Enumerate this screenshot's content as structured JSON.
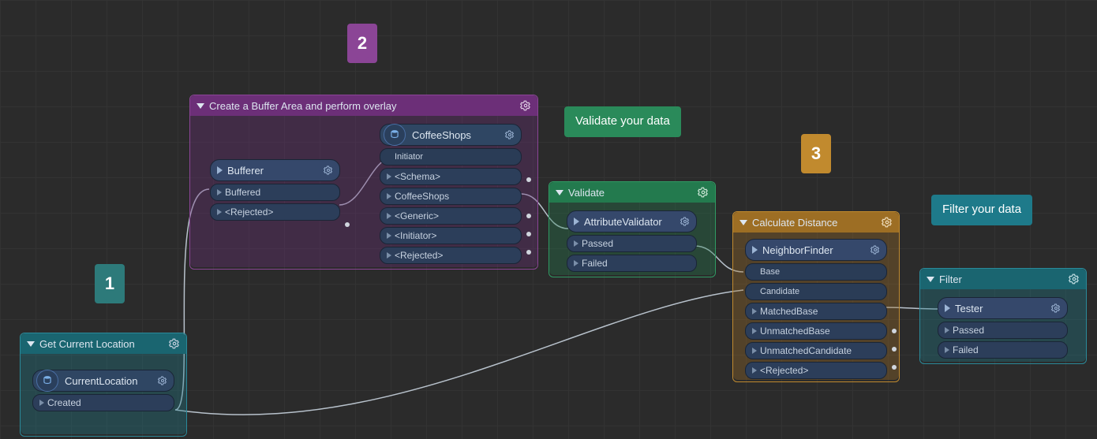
{
  "badges": {
    "one": "1",
    "two": "2",
    "three": "3"
  },
  "tips": {
    "validate": "Validate your data",
    "filter": "Filter your data"
  },
  "groups": {
    "loc": {
      "title": "Get Current Location"
    },
    "buf": {
      "title": "Create a Buffer Area and perform overlay"
    },
    "val": {
      "title": "Validate"
    },
    "dist": {
      "title": "Calculate Distance"
    },
    "filt": {
      "title": "Filter"
    }
  },
  "nodes": {
    "currentLocation": {
      "title": "CurrentLocation",
      "ports": [
        "Created"
      ]
    },
    "bufferer": {
      "title": "Bufferer",
      "ports": [
        "Buffered",
        "<Rejected>"
      ]
    },
    "coffeeShops": {
      "title": "CoffeeShops",
      "ports": [
        "Initiator",
        "<Schema>",
        "CoffeeShops",
        "<Generic>",
        "<Initiator>",
        "<Rejected>"
      ]
    },
    "attributeValidator": {
      "title": "AttributeValidator",
      "ports": [
        "Passed",
        "Failed"
      ]
    },
    "neighborFinder": {
      "title": "NeighborFinder",
      "ports": [
        "Base",
        "Candidate",
        "MatchedBase",
        "UnmatchedBase",
        "UnmatchedCandidate",
        "<Rejected>"
      ]
    },
    "tester": {
      "title": "Tester",
      "ports": [
        "Passed",
        "Failed"
      ]
    }
  },
  "colors": {
    "teal": "#1e7a8a",
    "purple": "#8b4596",
    "green": "#2a8a5a",
    "orange": "#c18a2e",
    "port": "#2c3e5a"
  }
}
